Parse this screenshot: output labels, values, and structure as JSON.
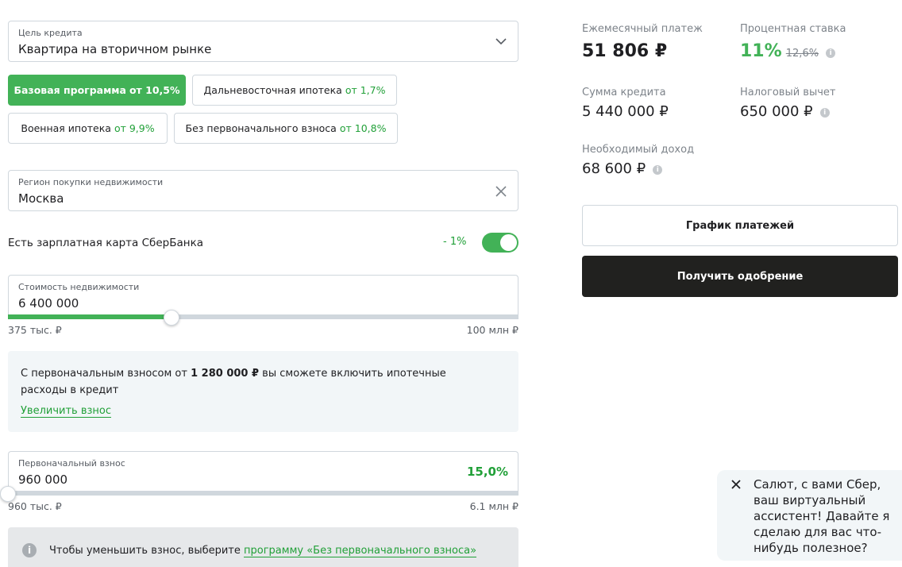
{
  "loan_purpose": {
    "label": "Цель кредита",
    "value": "Квартира на вторичном рынке",
    "icon": "chevron-down-icon"
  },
  "programs": [
    {
      "name": "Базовая программа",
      "rate": "от 10,5%",
      "active": true
    },
    {
      "name": "Дальневосточная ипотека",
      "rate": "от 1,7%",
      "active": false
    },
    {
      "name": "Военная ипотека",
      "rate": "от 9,9%",
      "active": false
    },
    {
      "name": "Без первоначального взноса",
      "rate": "от 10,8%",
      "active": false
    }
  ],
  "region": {
    "label": "Регион покупки недвижимости",
    "value": "Москва",
    "icon": "clear-icon"
  },
  "salary_card": {
    "label": "Есть зарплатная карта СберБанка",
    "discount": "- 1%",
    "enabled": true
  },
  "property_cost": {
    "label": "Стоимость недвижимости",
    "value": "6 400 000",
    "min_label": "375 тыс. ₽",
    "max_label": "100 млн ₽",
    "slider_fraction": 0.32
  },
  "down_payment_notice": {
    "text_before": "С первоначальным взносом от ",
    "amount": "1 280 000 ₽",
    "text_after": " вы сможете включить ипотечные расходы в кредит",
    "link": "Увеличить взнос"
  },
  "down_payment": {
    "label": "Первоначальный взнос",
    "value": "960 000",
    "percent": "15,0%",
    "min_label": "960 тыс. ₽",
    "max_label": "6.1 млн ₽",
    "slider_fraction": 0.0
  },
  "reduce_notice": {
    "text": "Чтобы уменьшить взнос, выберите ",
    "link": "программу «Без первоначального взноса»"
  },
  "summary": {
    "monthly_payment_label": "Ежемесячный платеж",
    "monthly_payment": "51 806 ₽",
    "rate_label": "Процентная ставка",
    "rate": "11%",
    "rate_old": "12,6%",
    "loan_amount_label": "Сумма кредита",
    "loan_amount": "5 440 000 ₽",
    "tax_deduction_label": "Налоговый вычет",
    "tax_deduction": "650 000 ₽",
    "required_income_label": "Необходимый доход",
    "required_income": "68 600 ₽"
  },
  "buttons": {
    "schedule": "График платежей",
    "approval": "Получить одобрение"
  },
  "assistant": {
    "message": "Салют, с вами Сбер, ваш виртуальный ассистент! Давайте я сделаю для вас что-нибудь полезное?"
  },
  "colors": {
    "accent_green": "#42b257",
    "dark_button": "#21211f",
    "info_bg": "#f2f6f8"
  }
}
